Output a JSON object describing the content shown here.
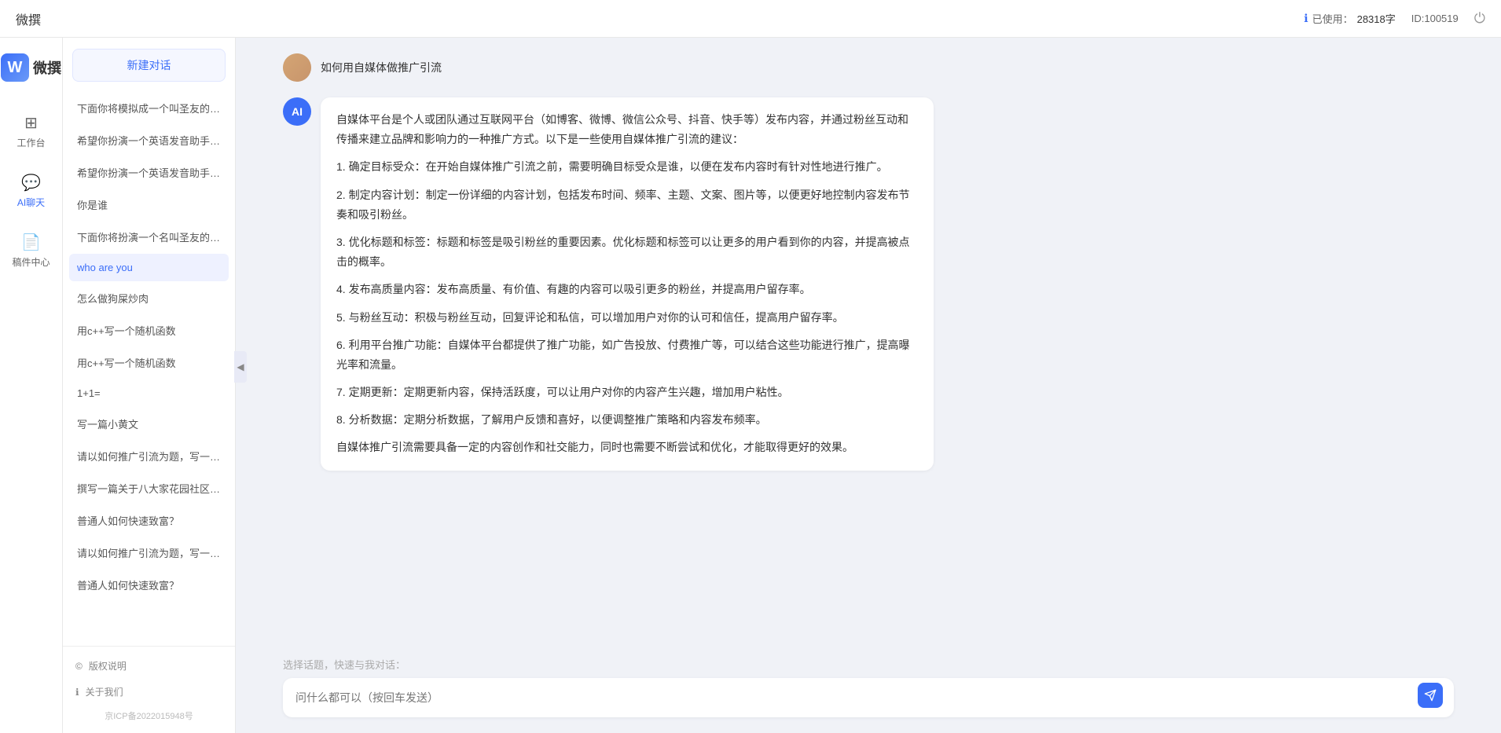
{
  "topbar": {
    "title": "微撰",
    "usage_label": "已使用：",
    "usage_count": "28318字",
    "id_label": "ID:100519",
    "usage_icon": "ℹ"
  },
  "brand": {
    "w_letter": "W",
    "name": "微撰"
  },
  "nav": {
    "items": [
      {
        "id": "workbench",
        "label": "工作台",
        "icon": "⊞"
      },
      {
        "id": "ai-chat",
        "label": "AI聊天",
        "icon": "💬",
        "active": true
      },
      {
        "id": "draft",
        "label": "稿件中心",
        "icon": "📄"
      }
    ]
  },
  "sidebar": {
    "new_btn": "新建对话",
    "items": [
      {
        "id": 1,
        "text": "下面你将模拟成一个叫圣友的程序员，我说...",
        "active": false
      },
      {
        "id": 2,
        "text": "希望你扮演一个英语发音助手，我提供给你...",
        "active": false
      },
      {
        "id": 3,
        "text": "希望你扮演一个英语发音助手，我提供给你...",
        "active": false
      },
      {
        "id": 4,
        "text": "你是谁",
        "active": false
      },
      {
        "id": 5,
        "text": "下面你将扮演一个名叫圣友的医生",
        "active": false
      },
      {
        "id": 6,
        "text": "who are you",
        "active": true
      },
      {
        "id": 7,
        "text": "怎么做狗屎炒肉",
        "active": false
      },
      {
        "id": 8,
        "text": "用c++写一个随机函数",
        "active": false
      },
      {
        "id": 9,
        "text": "用c++写一个随机函数",
        "active": false
      },
      {
        "id": 10,
        "text": "1+1=",
        "active": false
      },
      {
        "id": 11,
        "text": "写一篇小黄文",
        "active": false
      },
      {
        "id": 12,
        "text": "请以如何推广引流为题，写一篇大纲",
        "active": false
      },
      {
        "id": 13,
        "text": "撰写一篇关于八大家花园社区一刻钟便民生...",
        "active": false
      },
      {
        "id": 14,
        "text": "普通人如何快速致富？",
        "active": false
      },
      {
        "id": 15,
        "text": "请以如何推广引流为题，写一篇大纲",
        "active": false
      },
      {
        "id": 16,
        "text": "普通人如何快速致富？",
        "active": false
      }
    ],
    "footer_items": [
      {
        "id": "copyright",
        "label": "版权说明",
        "icon": "©"
      },
      {
        "id": "about",
        "label": "关于我们",
        "icon": "ℹ"
      }
    ],
    "icp": "京ICP备2022015948号"
  },
  "chat": {
    "user_message": "如何用自媒体做推广引流",
    "ai_response": {
      "paragraphs": [
        "自媒体平台是个人或团队通过互联网平台（如博客、微博、微信公众号、抖音、快手等）发布内容，并通过粉丝互动和传播来建立品牌和影响力的一种推广方式。以下是一些使用自媒体推广引流的建议：",
        "1. 确定目标受众：在开始自媒体推广引流之前，需要明确目标受众是谁，以便在发布内容时有针对性地进行推广。",
        "2. 制定内容计划：制定一份详细的内容计划，包括发布时间、频率、主题、文案、图片等，以便更好地控制内容发布节奏和吸引粉丝。",
        "3. 优化标题和标签：标题和标签是吸引粉丝的重要因素。优化标题和标签可以让更多的用户看到你的内容，并提高被点击的概率。",
        "4. 发布高质量内容：发布高质量、有价值、有趣的内容可以吸引更多的粉丝，并提高用户留存率。",
        "5. 与粉丝互动：积极与粉丝互动，回复评论和私信，可以增加用户对你的认可和信任，提高用户留存率。",
        "6. 利用平台推广功能：自媒体平台都提供了推广功能，如广告投放、付费推广等，可以结合这些功能进行推广，提高曝光率和流量。",
        "7. 定期更新：定期更新内容，保持活跃度，可以让用户对你的内容产生兴趣，增加用户粘性。",
        "8. 分析数据：定期分析数据，了解用户反馈和喜好，以便调整推广策略和内容发布频率。",
        "自媒体推广引流需要具备一定的内容创作和社交能力，同时也需要不断尝试和优化，才能取得更好的效果。"
      ]
    },
    "input_placeholder": "问什么都可以（按回车发送）",
    "quick_prompt_label": "选择话题，快速与我对话："
  }
}
